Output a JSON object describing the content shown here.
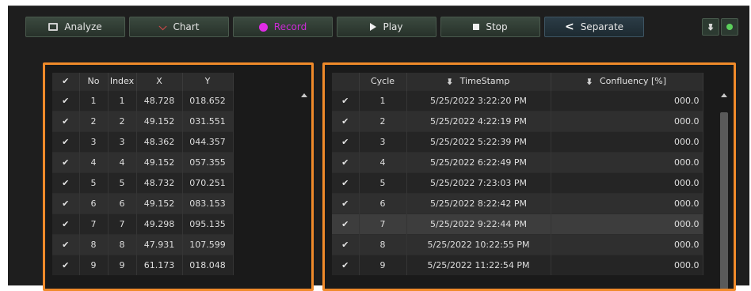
{
  "toolbar": {
    "analyze_label": "Analyze",
    "chart_label": "Chart",
    "record_label": "Record",
    "play_label": "Play",
    "stop_label": "Stop",
    "separate_label": "Separate"
  },
  "left_table": {
    "headers": {
      "check": "✔",
      "no": "No",
      "index": "Index",
      "x": "X",
      "y": "Y"
    },
    "rows": [
      {
        "no": "1",
        "index": "1",
        "x": "48.728",
        "y": "018.652"
      },
      {
        "no": "2",
        "index": "2",
        "x": "49.152",
        "y": "031.551"
      },
      {
        "no": "3",
        "index": "3",
        "x": "48.362",
        "y": "044.357"
      },
      {
        "no": "4",
        "index": "4",
        "x": "49.152",
        "y": "057.355"
      },
      {
        "no": "5",
        "index": "5",
        "x": "48.732",
        "y": "070.251"
      },
      {
        "no": "6",
        "index": "6",
        "x": "49.152",
        "y": "083.153"
      },
      {
        "no": "7",
        "index": "7",
        "x": "49.298",
        "y": "095.135"
      },
      {
        "no": "8",
        "index": "8",
        "x": "47.931",
        "y": "107.599"
      },
      {
        "no": "9",
        "index": "9",
        "x": "61.173",
        "y": "018.048"
      }
    ]
  },
  "right_table": {
    "headers": {
      "cycle": "Cycle",
      "timestamp": "TimeStamp",
      "confluency": "Confluency [%]"
    },
    "rows": [
      {
        "cycle": "1",
        "timestamp": "5/25/2022 3:22:20 PM",
        "confluency": "000.0"
      },
      {
        "cycle": "2",
        "timestamp": "5/25/2022 4:22:19 PM",
        "confluency": "000.0"
      },
      {
        "cycle": "3",
        "timestamp": "5/25/2022 5:22:39 PM",
        "confluency": "000.0"
      },
      {
        "cycle": "4",
        "timestamp": "5/25/2022 6:22:49 PM",
        "confluency": "000.0"
      },
      {
        "cycle": "5",
        "timestamp": "5/25/2022 7:23:03 PM",
        "confluency": "000.0"
      },
      {
        "cycle": "6",
        "timestamp": "5/25/2022 8:22:42 PM",
        "confluency": "000.0"
      },
      {
        "cycle": "7",
        "timestamp": "5/25/2022 9:22:44 PM",
        "confluency": "000.0"
      },
      {
        "cycle": "8",
        "timestamp": "5/25/2022 10:22:55 PM",
        "confluency": "000.0"
      },
      {
        "cycle": "9",
        "timestamp": "5/25/2022 11:22:54 PM",
        "confluency": "000.0"
      }
    ]
  },
  "icons": {
    "analyze": "monitor-icon",
    "chart": "chart-icon",
    "record": "record-dot-icon",
    "play": "play-icon",
    "stop": "stop-icon",
    "separate": "separate-icon",
    "pin": "pin-icon",
    "status": "green-status-icon",
    "check": "checkmark-icon"
  },
  "colors": {
    "panel_highlight": "#f08a2a",
    "record": "#e02ce6",
    "status_green": "#5bd05b",
    "background": "#1e1e1e"
  }
}
